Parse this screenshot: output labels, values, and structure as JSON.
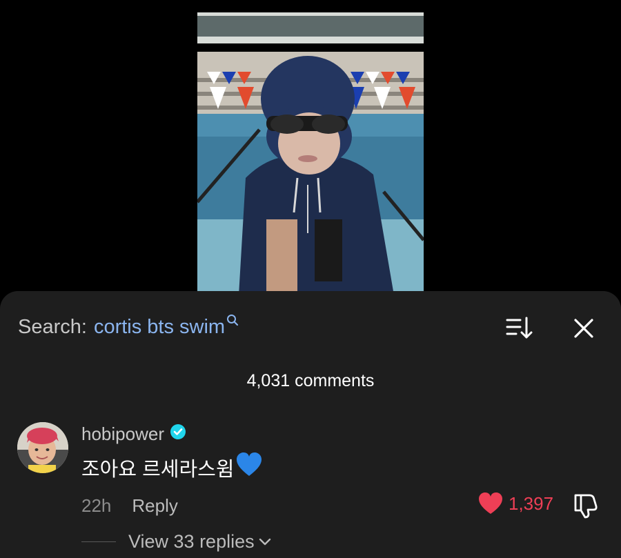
{
  "search": {
    "prefix": "Search:",
    "query": "cortis bts swim"
  },
  "comments_header": {
    "count_label": "4,031 comments"
  },
  "comment": {
    "username": "hobipower",
    "text": "조아요 르세라스윔",
    "time": "22h",
    "reply_label": "Reply",
    "like_count": "1,397",
    "view_replies_label": "View 33 replies"
  },
  "colors": {
    "sheet_bg": "#1e1e1e",
    "search_query": "#8bb5ef",
    "like_red": "#ee3f56",
    "verified_blue": "#20d5ec",
    "heart_emoji_blue": "#2b86e8"
  },
  "icons": [
    "search-icon",
    "sort-icon",
    "close-icon",
    "verified-badge-icon",
    "blue-heart-emoji",
    "heart-icon",
    "dislike-icon",
    "chevron-down-icon"
  ]
}
